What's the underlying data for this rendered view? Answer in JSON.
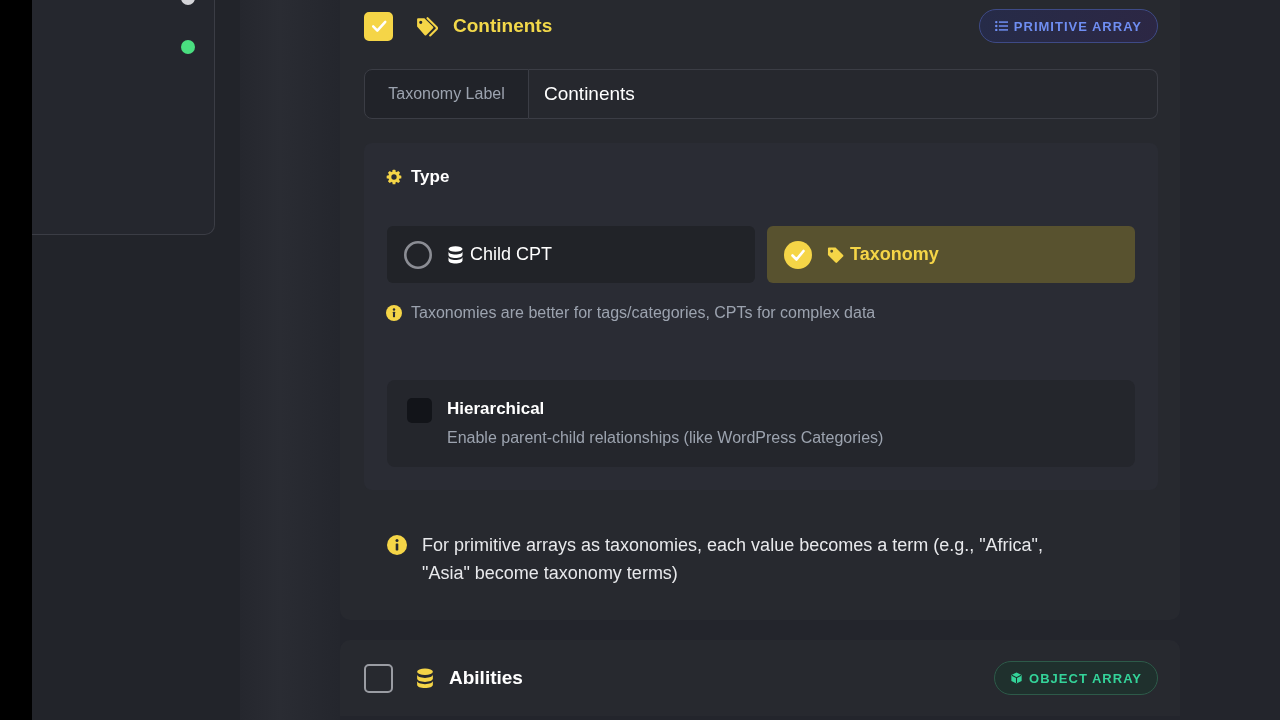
{
  "sidebar": {
    "status_dots": [
      {
        "color": "#d4d4d8"
      },
      {
        "color": "#4ade80"
      }
    ]
  },
  "fields": [
    {
      "kind": "primitive_array",
      "checked": true,
      "title": "Continents",
      "badge": "PRIMITIVE ARRAY",
      "settings": {
        "label_field": {
          "label": "Taxonomy Label",
          "value": "Continents"
        },
        "type_section": {
          "title": "Type",
          "options": [
            {
              "kind": "cpt",
              "label": "Child CPT",
              "selected": false
            },
            {
              "kind": "taxonomy",
              "label": "Taxonomy",
              "selected": true
            }
          ],
          "hint": "Taxonomies are better for tags/categories, CPTs for complex data",
          "hierarchical": {
            "checked": false,
            "title": "Hierarchical",
            "description": "Enable parent-child relationships (like WordPress Categories)"
          }
        },
        "note": "For primitive arrays as taxonomies, each value becomes a term (e.g., \"Africa\", \"Asia\" become taxonomy terms)"
      }
    },
    {
      "kind": "object_array",
      "checked": false,
      "title": "Abilities",
      "badge": "OBJECT ARRAY"
    }
  ]
}
